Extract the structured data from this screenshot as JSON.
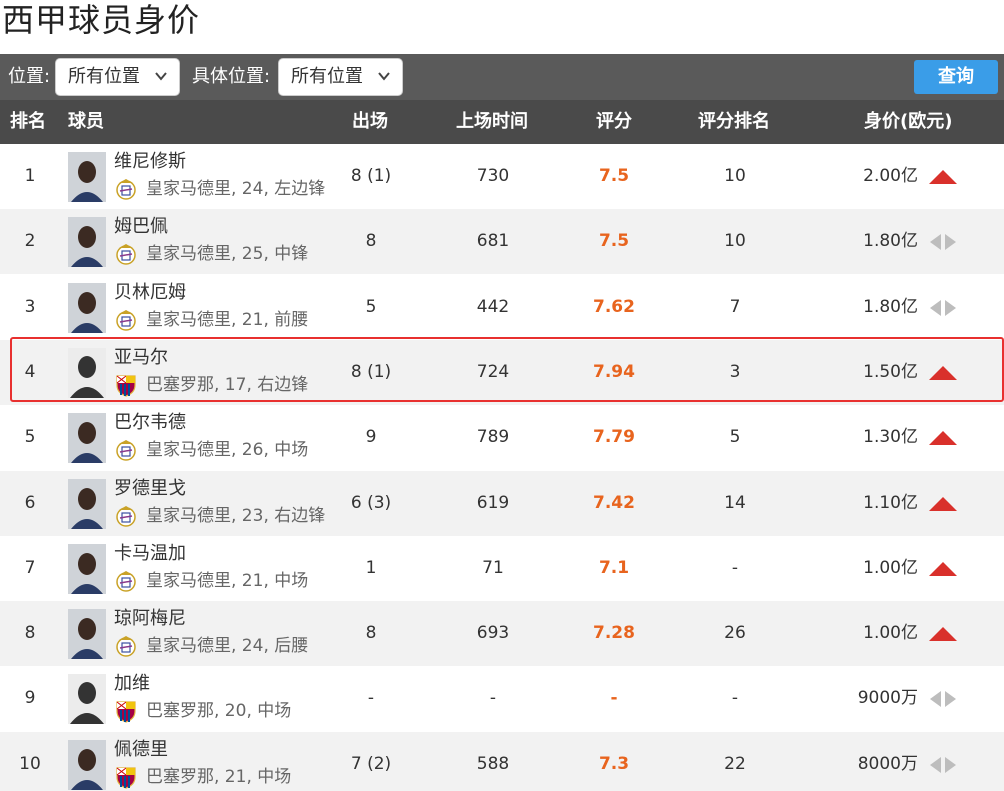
{
  "page": {
    "title": "西甲球员身价"
  },
  "filters": {
    "position_label": "位置:",
    "position_value": "所有位置",
    "detail_position_label": "具体位置:",
    "detail_position_value": "所有位置",
    "query_label": "查询"
  },
  "table": {
    "headers": {
      "rank": "排名",
      "player": "球员",
      "appearances": "出场",
      "minutes": "上场时间",
      "rating": "评分",
      "rating_rank": "评分排名",
      "value": "身价(欧元)"
    },
    "rows": [
      {
        "rank": "1",
        "name": "维尼修斯",
        "info": "皇家马德里, 24, 左边锋",
        "club": "real-madrid",
        "appearances": "8 (1)",
        "minutes": "730",
        "rating": "7.5",
        "rating_rank": "10",
        "value": "2.00亿",
        "trend": "up"
      },
      {
        "rank": "2",
        "name": "姆巴佩",
        "info": "皇家马德里, 25, 中锋",
        "club": "real-madrid",
        "appearances": "8",
        "minutes": "681",
        "rating": "7.5",
        "rating_rank": "10",
        "value": "1.80亿",
        "trend": "flat"
      },
      {
        "rank": "3",
        "name": "贝林厄姆",
        "info": "皇家马德里, 21, 前腰",
        "club": "real-madrid",
        "appearances": "5",
        "minutes": "442",
        "rating": "7.62",
        "rating_rank": "7",
        "value": "1.80亿",
        "trend": "flat"
      },
      {
        "rank": "4",
        "name": "亚马尔",
        "info": "巴塞罗那, 17, 右边锋",
        "club": "barcelona",
        "appearances": "8 (1)",
        "minutes": "724",
        "rating": "7.94",
        "rating_rank": "3",
        "value": "1.50亿",
        "trend": "up"
      },
      {
        "rank": "5",
        "name": "巴尔韦德",
        "info": "皇家马德里, 26, 中场",
        "club": "real-madrid",
        "appearances": "9",
        "minutes": "789",
        "rating": "7.79",
        "rating_rank": "5",
        "value": "1.30亿",
        "trend": "up"
      },
      {
        "rank": "6",
        "name": "罗德里戈",
        "info": "皇家马德里, 23, 右边锋",
        "club": "real-madrid",
        "appearances": "6 (3)",
        "minutes": "619",
        "rating": "7.42",
        "rating_rank": "14",
        "value": "1.10亿",
        "trend": "up"
      },
      {
        "rank": "7",
        "name": "卡马温加",
        "info": "皇家马德里, 21, 中场",
        "club": "real-madrid",
        "appearances": "1",
        "minutes": "71",
        "rating": "7.1",
        "rating_rank": "-",
        "value": "1.00亿",
        "trend": "up"
      },
      {
        "rank": "8",
        "name": "琼阿梅尼",
        "info": "皇家马德里, 24, 后腰",
        "club": "real-madrid",
        "appearances": "8",
        "minutes": "693",
        "rating": "7.28",
        "rating_rank": "26",
        "value": "1.00亿",
        "trend": "up"
      },
      {
        "rank": "9",
        "name": "加维",
        "info": "巴塞罗那, 20, 中场",
        "club": "barcelona",
        "appearances": "-",
        "minutes": "-",
        "rating": "-",
        "rating_rank": "-",
        "value": "9000万",
        "trend": "flat"
      },
      {
        "rank": "10",
        "name": "佩德里",
        "info": "巴塞罗那, 21, 中场",
        "club": "barcelona",
        "appearances": "7 (2)",
        "minutes": "588",
        "rating": "7.3",
        "rating_rank": "22",
        "value": "8000万",
        "trend": "flat"
      }
    ]
  },
  "colors": {
    "accent_blue": "#3a9de8",
    "rating_orange": "#e8641e",
    "trend_up_red": "#d9302b",
    "highlight_red": "#e8302f"
  }
}
